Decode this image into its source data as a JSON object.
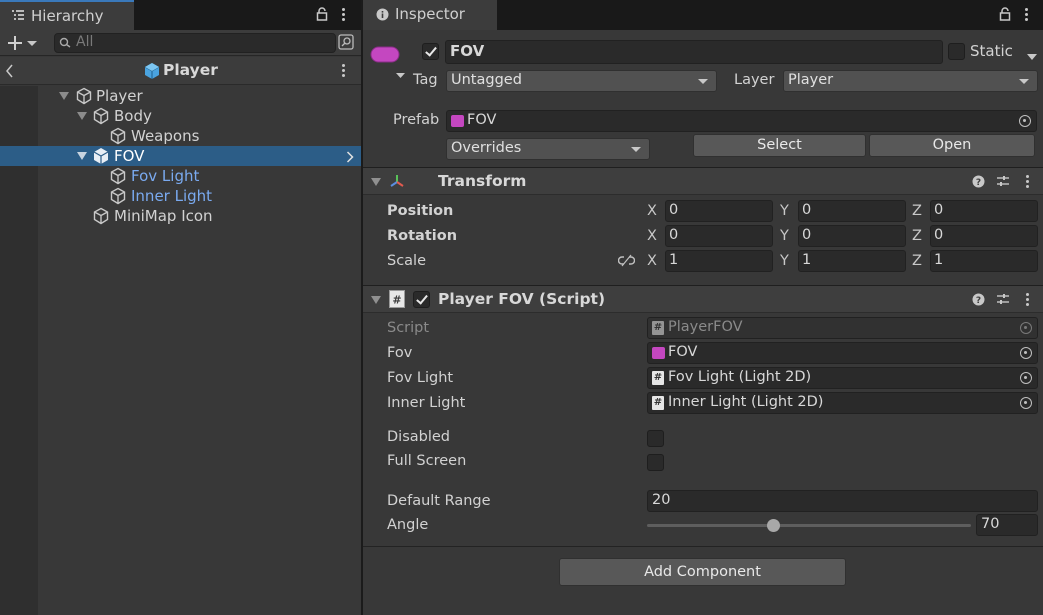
{
  "hierarchy": {
    "tab_label": "Hierarchy",
    "search_placeholder": "All",
    "scene_title": "Player",
    "items": [
      {
        "label": "Player"
      },
      {
        "label": "Body"
      },
      {
        "label": "Weapons"
      },
      {
        "label": "FOV"
      },
      {
        "label": "Fov Light"
      },
      {
        "label": "Inner Light"
      },
      {
        "label": "MiniMap Icon"
      }
    ]
  },
  "inspector": {
    "tab_label": "Inspector",
    "object_name": "FOV",
    "static_label": "Static",
    "tag_label": "Tag",
    "tag_value": "Untagged",
    "layer_label": "Layer",
    "layer_value": "Player",
    "prefab_label": "Prefab",
    "prefab_value": "FOV",
    "overrides_label": "Overrides",
    "select_label": "Select",
    "open_label": "Open",
    "transform": {
      "title": "Transform",
      "rows": [
        {
          "label": "Position",
          "x": "0",
          "y": "0",
          "z": "0"
        },
        {
          "label": "Rotation",
          "x": "0",
          "y": "0",
          "z": "0"
        },
        {
          "label": "Scale",
          "x": "1",
          "y": "1",
          "z": "1"
        }
      ],
      "axis_x": "X",
      "axis_y": "Y",
      "axis_z": "Z"
    },
    "script_component": {
      "title": "Player FOV (Script)",
      "script_label": "Script",
      "script_value": "PlayerFOV",
      "fov_label": "Fov",
      "fov_value": "FOV",
      "fov_light_label": "Fov Light",
      "fov_light_value": "Fov Light (Light 2D)",
      "inner_light_label": "Inner Light",
      "inner_light_value": "Inner Light (Light 2D)",
      "disabled_label": "Disabled",
      "full_screen_label": "Full Screen",
      "default_range_label": "Default Range",
      "default_range_value": "20",
      "angle_label": "Angle",
      "angle_value": "70",
      "angle_slider_fraction": 0.39
    },
    "add_component_label": "Add Component"
  },
  "colors": {
    "selection": "#2c5d87",
    "prefab_accent": "#c447c0",
    "child_text": "#7aaaf0"
  }
}
